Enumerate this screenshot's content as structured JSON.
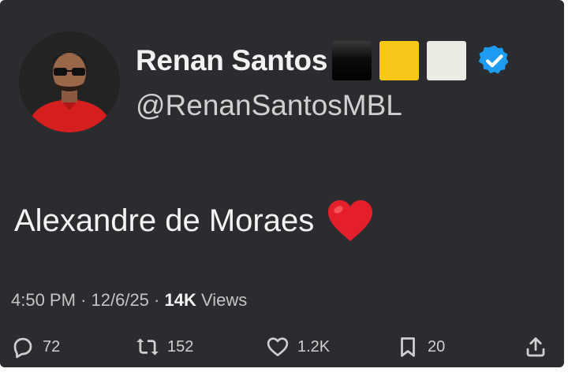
{
  "author": {
    "name": "Renan Santos",
    "handle": "@RenanSantosMBL",
    "flag_colors": [
      "#000000",
      "#f7c81a",
      "#ecebe3"
    ],
    "verified_color": "#1d9bf0"
  },
  "tweet": {
    "text": "Alexandre de Moraes",
    "emoji": "red-heart"
  },
  "meta": {
    "time": "4:50 PM",
    "date": "12/6/25",
    "views_count": "14K",
    "views_label": "Views"
  },
  "actions": {
    "replies": "72",
    "reposts": "152",
    "likes": "1.2K",
    "bookmarks": "20"
  }
}
